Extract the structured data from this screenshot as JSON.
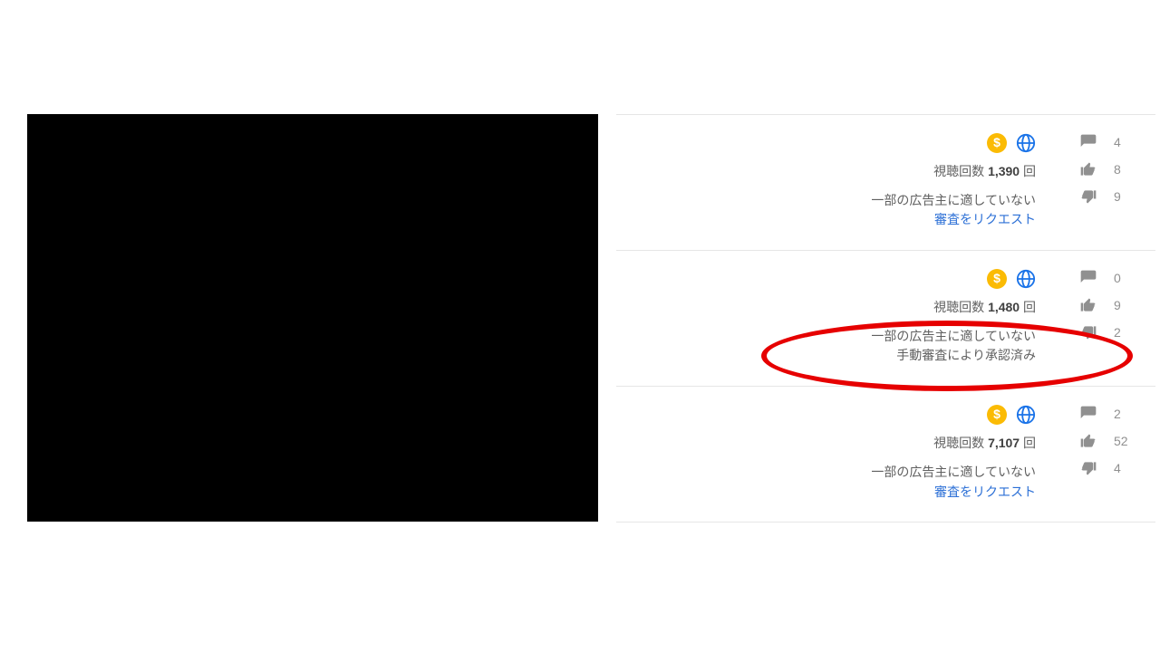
{
  "colors": {
    "monetization_limited": "#fbbb04",
    "globe": "#1a73e8",
    "icon_grey": "#909090",
    "link": "#2b6fd6",
    "annotation": "#e60000"
  },
  "labels": {
    "views_prefix": "視聴回数",
    "views_suffix": "回",
    "not_suitable": "一部の広告主に適していない",
    "request_review": "審査をリクエスト",
    "approved_manual": "手動審査により承認済み"
  },
  "glyphs": {
    "dollar": "$"
  },
  "rows": [
    {
      "views": "1,390",
      "comments": "4",
      "likes": "8",
      "dislikes": "9",
      "status": "request"
    },
    {
      "views": "1,480",
      "comments": "0",
      "likes": "9",
      "dislikes": "2",
      "status": "approved"
    },
    {
      "views": "7,107",
      "comments": "2",
      "likes": "52",
      "dislikes": "4",
      "status": "request"
    }
  ],
  "annotation": {
    "target_row": 1
  }
}
